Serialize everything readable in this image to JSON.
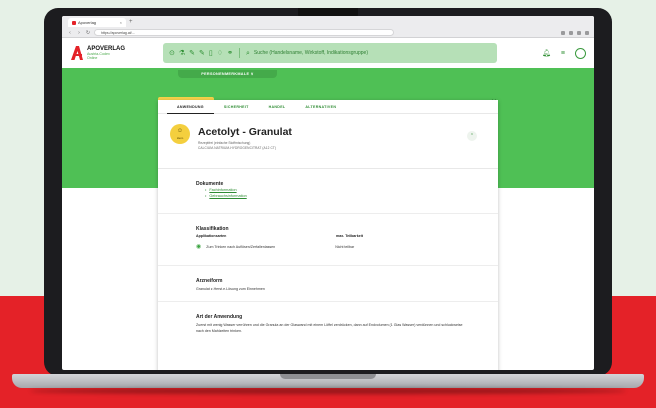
{
  "colors": {
    "brand_green": "#4fc055",
    "brand_red": "#e42228",
    "hero_yellow": "#f4cf3e"
  },
  "browser": {
    "tab_title": "Apoverlag",
    "url": "https://apoverlag.at/..."
  },
  "header": {
    "logo_title": "APOVERLAG",
    "logo_subtitle_line1": "Austria-Codex",
    "logo_subtitle_line2": "Online",
    "search_placeholder": "Suche (Handelsname, Wirkstoff, Indikationsgruppe)",
    "icons": [
      "bell-icon",
      "menu-icon",
      "user-icon"
    ]
  },
  "filter_bar": {
    "label": "PERSONENMERKMALE ∨"
  },
  "chip": {
    "label": "Acetolyt - Granulat"
  },
  "card": {
    "tabs": [
      "ANWENDUNG",
      "SICHERHEIT",
      "HANDEL",
      "ALTERNATIVEN"
    ],
    "drug_name": "Acetolyt - Granulat",
    "drug_subtitle": "Rezeptfrei (einfache Stoffmischung)",
    "drug_substance": "CALCIUM-NATRIUM-HYDROGENCITRAT (A12 CT)",
    "hero_label": "Hero",
    "sections": {
      "documents": {
        "title": "Dokumente",
        "links": [
          "Fachinformation",
          "Gebrauchsinformation"
        ]
      },
      "classification": {
        "title": "Klassifikation",
        "col1_header": "Applikationsarten",
        "col2_header": "max. Teilbarkeit",
        "row_col1": "Zum Trinken nach Auflösen/Zerfallenlassen",
        "row_col2": "Nicht teilbar"
      },
      "dosage_form": {
        "title": "Arzneiform",
        "text": "Granulat z.Herst.e.Lösung zum Einnehmen"
      },
      "application": {
        "title": "Art der Anwendung",
        "text": "Zuerst mit wenig Wasser verrühren und die Granula an der Glaswand mit einem Löffel zerdrücken, dann auf Endvolumen (1 Glas Wasser) verdünnen und schluckweise nach den Mahlzeiten trinken."
      }
    }
  }
}
